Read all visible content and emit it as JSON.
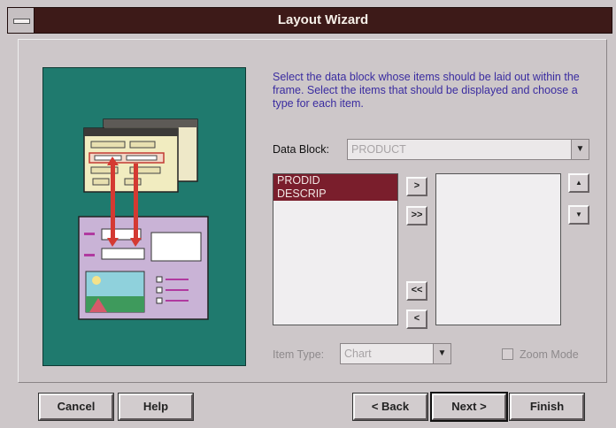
{
  "window": {
    "title": "Layout Wizard"
  },
  "instructions": "Select the data block whose items should be laid out within the frame. Select the items that should be displayed and choose a type for each item.",
  "data_block": {
    "label": "Data Block:",
    "value": "PRODUCT"
  },
  "available_items": [
    "PRODID",
    "DESCRIP"
  ],
  "move_buttons": {
    "add_one": ">",
    "add_all": ">>",
    "remove_all": "<<",
    "remove_one": "<"
  },
  "order_buttons": {
    "up": "▲",
    "down": "▼"
  },
  "item_type": {
    "label": "Item Type:",
    "value": "Chart"
  },
  "zoom_mode": {
    "label": "Zoom Mode",
    "checked": false
  },
  "buttons": {
    "cancel": "Cancel",
    "help": "Help",
    "back": "< Back",
    "next": "Next >",
    "finish": "Finish"
  }
}
